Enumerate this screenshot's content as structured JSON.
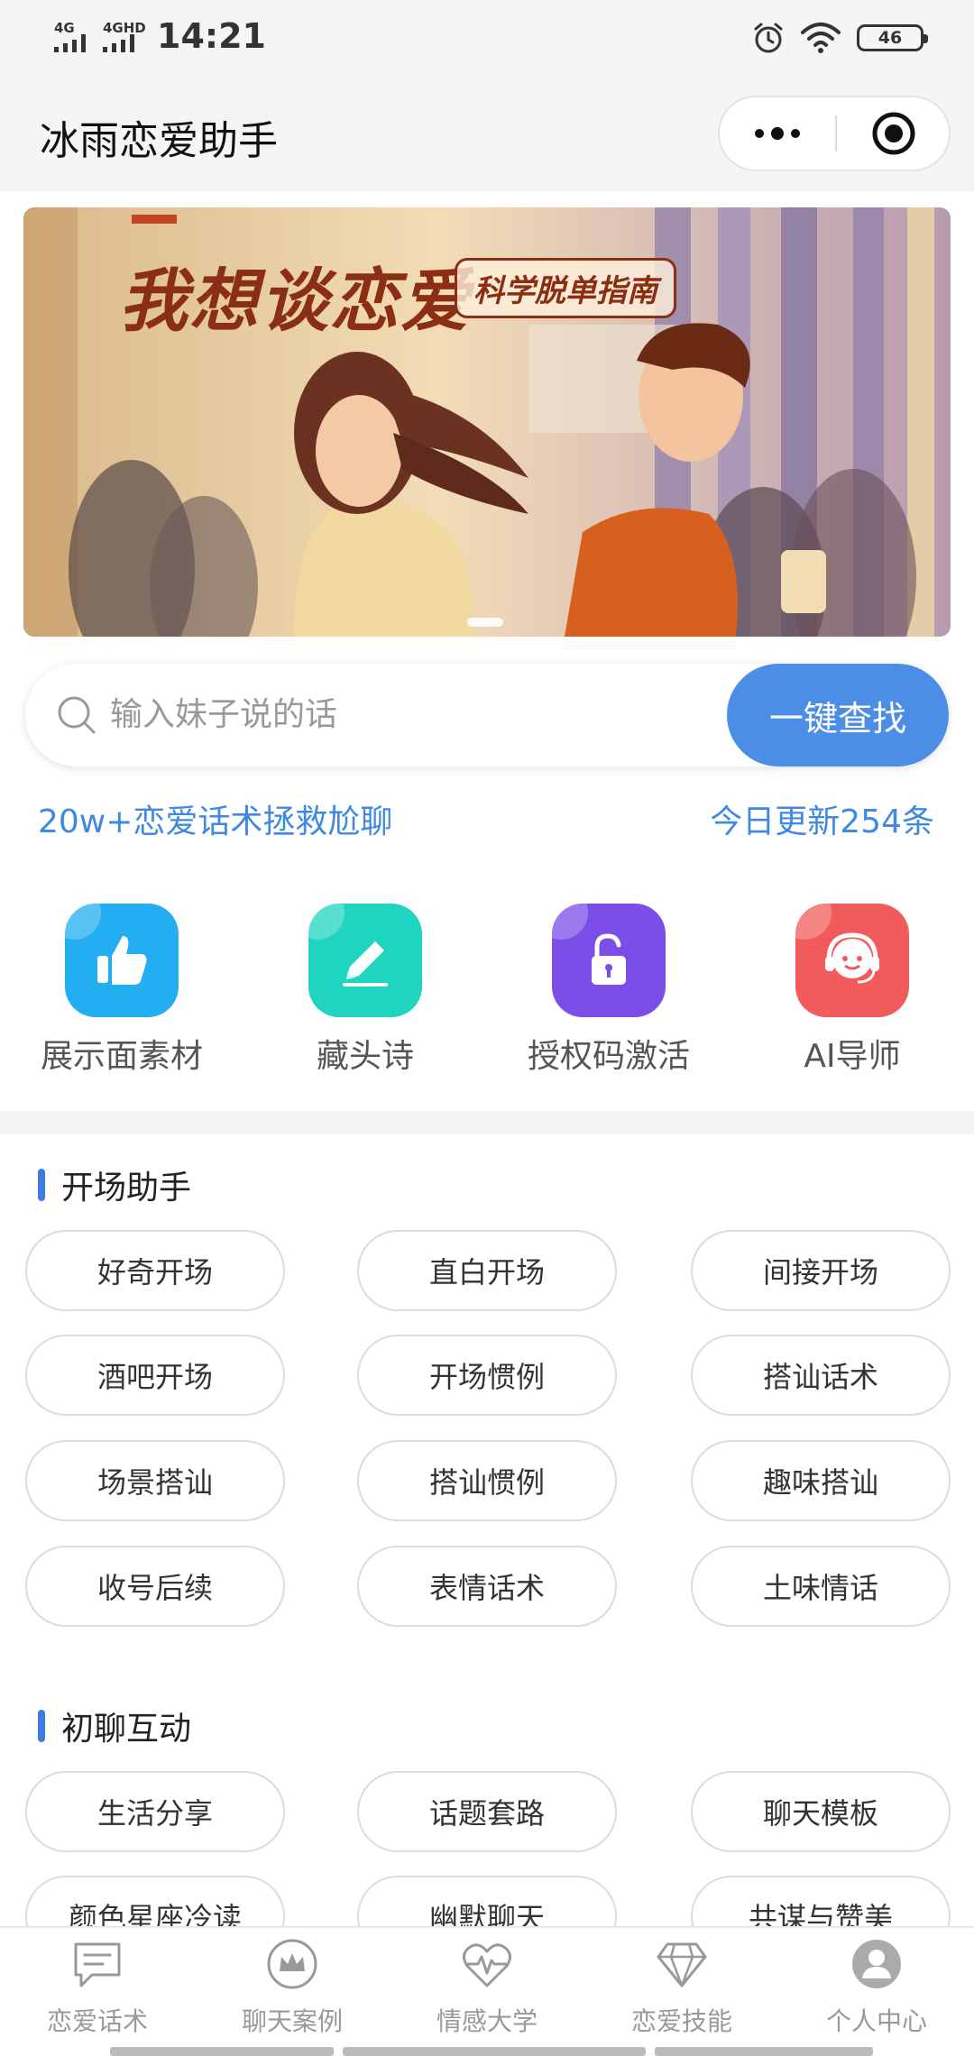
{
  "status_bar": {
    "signal_1": "4G",
    "signal_2": "4GHD",
    "time": "14:21",
    "battery": "46",
    "icons": [
      "alarm-icon",
      "wifi-icon",
      "battery-icon"
    ]
  },
  "title_bar": {
    "title": "冰雨恋爱助手",
    "icons": [
      "more-icon",
      "close-miniprogram-icon"
    ]
  },
  "banner": {
    "title": "我想谈恋爱",
    "subtitle": "科学脱单指南",
    "active_slide": 1
  },
  "search": {
    "placeholder": "输入妹子说的话",
    "value": "",
    "button": "一键查找"
  },
  "promo": {
    "left": "20w+恋爱话术拯救尬聊",
    "right": "今日更新254条"
  },
  "shortcuts": [
    {
      "label": "展示面素材",
      "icon": "thumbs-up-icon",
      "color": "#22aef0"
    },
    {
      "label": "藏头诗",
      "icon": "pencil-icon",
      "color": "#1fd4c0"
    },
    {
      "label": "授权码激活",
      "icon": "unlock-icon",
      "color": "#7b4ee8"
    },
    {
      "label": "AI导师",
      "icon": "headset-icon",
      "color": "#f25b5b"
    }
  ],
  "sections": [
    {
      "title": "开场助手",
      "items": [
        "好奇开场",
        "直白开场",
        "间接开场",
        "酒吧开场",
        "开场惯例",
        "搭讪话术",
        "场景搭讪",
        "搭讪惯例",
        "趣味搭讪",
        "收号后续",
        "表情话术",
        "土味情话"
      ]
    },
    {
      "title": "初聊互动",
      "items": [
        "生活分享",
        "话题套路",
        "聊天模板",
        "颜色星座冷读",
        "幽默聊天",
        "共谋与赞美"
      ]
    }
  ],
  "tabbar": [
    {
      "label": "恋爱话术",
      "icon": "chat-bubble-icon"
    },
    {
      "label": "聊天案例",
      "icon": "crown-icon"
    },
    {
      "label": "情感大学",
      "icon": "heartbeat-icon"
    },
    {
      "label": "恋爱技能",
      "icon": "diamond-icon"
    },
    {
      "label": "个人中心",
      "icon": "user-icon"
    }
  ],
  "colors": {
    "accent": "#4c8de6",
    "link": "#3f8ae0",
    "section_bar": "#3f7be0",
    "tab_inactive": "#999999"
  }
}
